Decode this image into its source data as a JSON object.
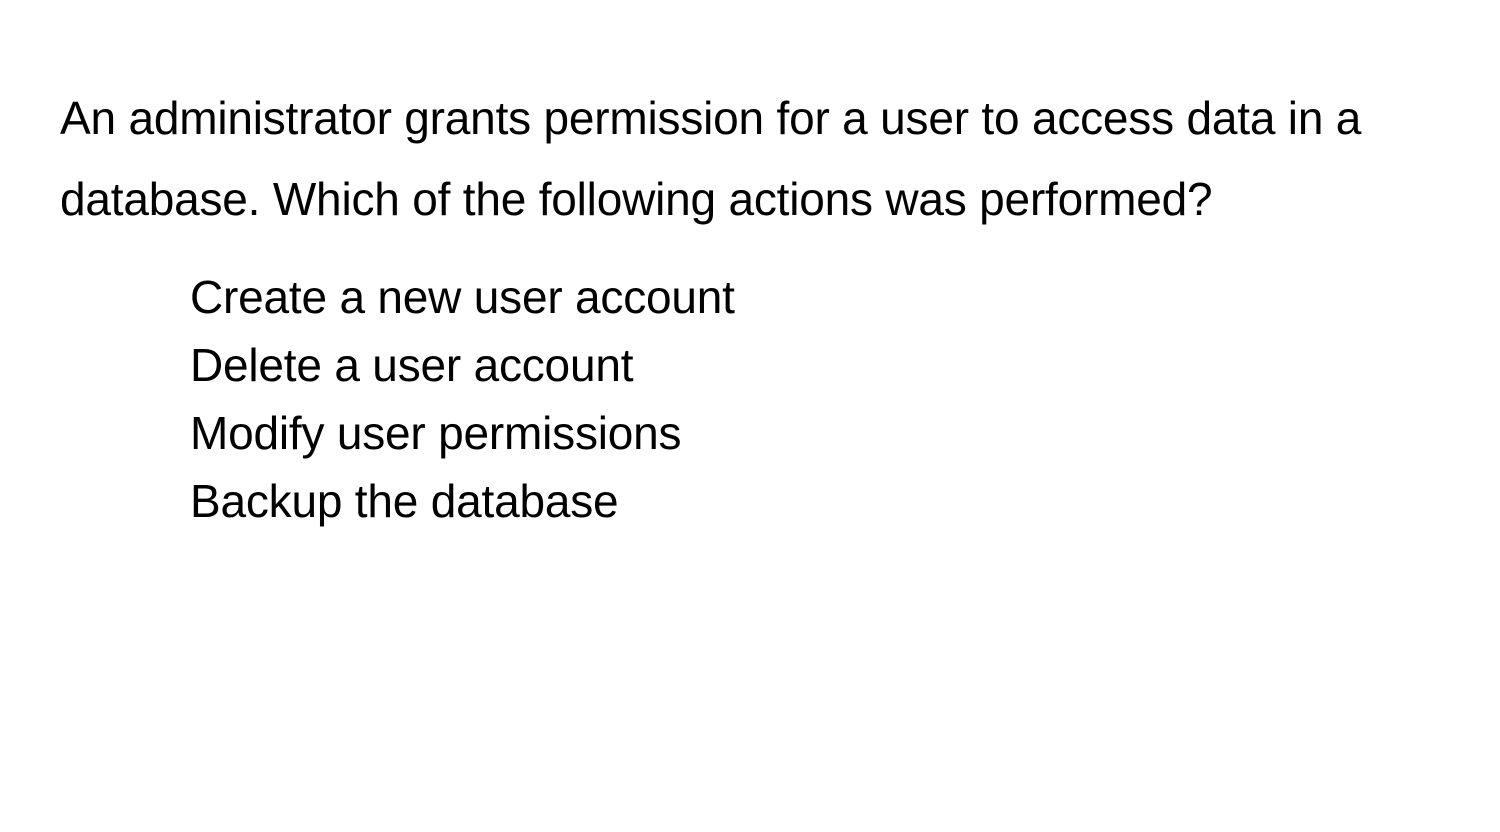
{
  "question": "An administrator grants permission for a user to access data in a database. Which of the following actions was performed?",
  "options": [
    "Create a new user account",
    "Delete a user account",
    "Modify user permissions",
    "Backup the database"
  ]
}
